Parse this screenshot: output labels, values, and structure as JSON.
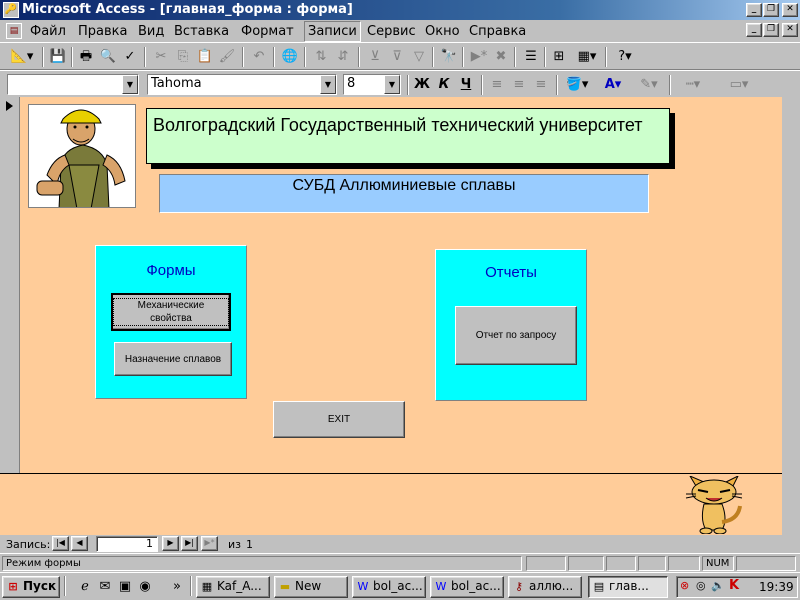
{
  "window": {
    "title": "Microsoft Access - [главная_форма : форма]",
    "min_glyph": "_",
    "max_glyph": "❐",
    "close_glyph": "✕"
  },
  "menu": [
    "Файл",
    "Правка",
    "Вид",
    "Вставка",
    "Формат",
    "Записи",
    "Сервис",
    "Окно",
    "Справка"
  ],
  "menu_active": "Записи",
  "toolbar": {
    "icons": [
      "design-view",
      "save",
      "print",
      "print-preview",
      "spelling",
      "cut",
      "copy",
      "paste",
      "format-painter",
      "undo",
      "insert-hyperlink",
      "sort-ascending",
      "sort-descending",
      "filter-by-selection",
      "filter-by-form",
      "apply-filter",
      "find",
      "new-record",
      "delete-record",
      "properties",
      "database-window",
      "new-object",
      "help"
    ],
    "font_name": "Tahoma",
    "font_size": "8",
    "bold_label": "Ж",
    "italic_label": "К",
    "underline_label": "Ч",
    "object_combo": ""
  },
  "colors": {
    "form_bg": "#ffcc99",
    "title_box": "#ccffcc",
    "subtitle_box": "#99ccff",
    "panel": "#00ffff",
    "panel_title": "#0000c0"
  },
  "form": {
    "university": "Волгоградский Государственный технический университет",
    "subtitle": "СУБД Аллюминиевые сплавы",
    "forms_panel": {
      "title": "Формы",
      "buttons": [
        "Механические свойства",
        "Назначение сплавов"
      ]
    },
    "reports_panel": {
      "title": "Отчеты",
      "buttons": [
        "Отчет по запросу"
      ]
    },
    "exit_label": "EXIT"
  },
  "record_nav": {
    "label": "Запись:",
    "current": "1",
    "of_label": "из",
    "total": "1"
  },
  "status": {
    "text": "Режим формы",
    "num": "NUM"
  },
  "taskbar": {
    "start": "Пуск",
    "tasks": [
      "Kaf_A...",
      "New",
      "bol_ac...",
      "bol_ac...",
      "аллю...",
      "глав..."
    ],
    "clock": "19:39"
  }
}
